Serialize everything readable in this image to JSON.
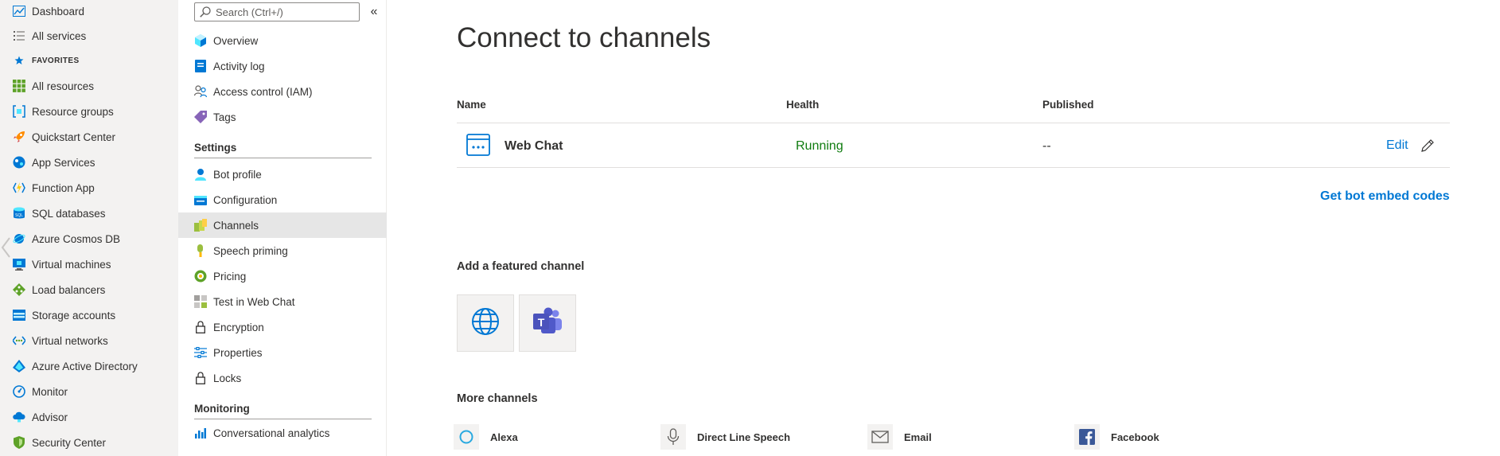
{
  "portal_nav": {
    "favorites_label": "FAVORITES",
    "items": [
      {
        "label": "Dashboard"
      },
      {
        "label": "All services"
      },
      {
        "label": "All resources"
      },
      {
        "label": "Resource groups"
      },
      {
        "label": "Quickstart Center"
      },
      {
        "label": "App Services"
      },
      {
        "label": "Function App"
      },
      {
        "label": "SQL databases"
      },
      {
        "label": "Azure Cosmos DB"
      },
      {
        "label": "Virtual machines"
      },
      {
        "label": "Load balancers"
      },
      {
        "label": "Storage accounts"
      },
      {
        "label": "Virtual networks"
      },
      {
        "label": "Azure Active Directory"
      },
      {
        "label": "Monitor"
      },
      {
        "label": "Advisor"
      },
      {
        "label": "Security Center"
      }
    ]
  },
  "resource_menu": {
    "search_placeholder": "Search (Ctrl+/)",
    "collapse_glyph": "«",
    "top_items": [
      {
        "label": "Overview"
      },
      {
        "label": "Activity log"
      },
      {
        "label": "Access control (IAM)"
      },
      {
        "label": "Tags"
      }
    ],
    "settings_header": "Settings",
    "settings_items": [
      {
        "label": "Bot profile"
      },
      {
        "label": "Configuration"
      },
      {
        "label": "Channels"
      },
      {
        "label": "Speech priming"
      },
      {
        "label": "Pricing"
      },
      {
        "label": "Test in Web Chat"
      },
      {
        "label": "Encryption"
      },
      {
        "label": "Properties"
      },
      {
        "label": "Locks"
      }
    ],
    "monitoring_header": "Monitoring",
    "monitoring_items": [
      {
        "label": "Conversational analytics"
      }
    ]
  },
  "main": {
    "title": "Connect to channels",
    "columns": {
      "name": "Name",
      "health": "Health",
      "published": "Published"
    },
    "rows": [
      {
        "name": "Web Chat",
        "health": "Running",
        "published": "--",
        "edit": "Edit"
      }
    ],
    "embed_link": "Get bot embed codes",
    "featured_title": "Add a featured channel",
    "more_title": "More channels",
    "more_channels": [
      {
        "label": "Alexa"
      },
      {
        "label": "Direct Line Speech"
      },
      {
        "label": "Email"
      },
      {
        "label": "Facebook"
      }
    ]
  },
  "colors": {
    "accent": "#0078d4",
    "running": "#107c10",
    "nav_bg": "#f3f2f1",
    "selected_bg": "#e6e6e6"
  }
}
